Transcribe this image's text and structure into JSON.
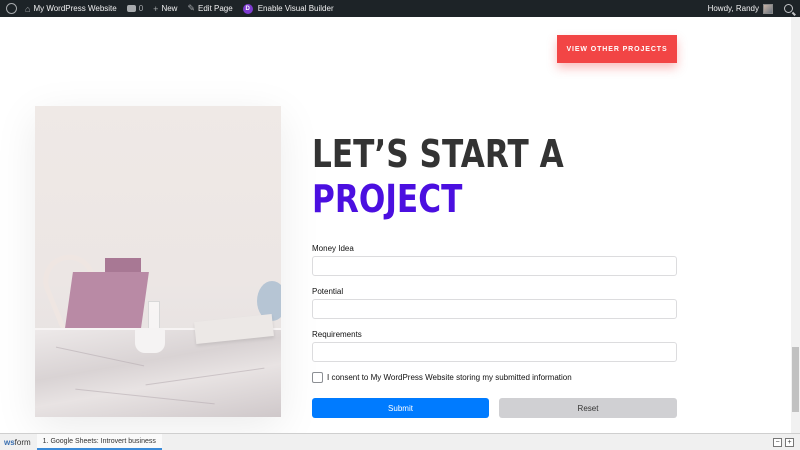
{
  "admin_bar": {
    "site_name": "My WordPress Website",
    "comments_count": "0",
    "new_label": "New",
    "edit_label": "Edit Page",
    "visual_builder_label": "Enable Visual Builder",
    "divi_letter": "D",
    "greeting": "Howdy, Randy"
  },
  "page": {
    "view_projects_label": "VIEW OTHER PROJECTS",
    "heading_line1": "LET’S START A",
    "heading_line2": "PROJECT",
    "accent_color": "#4b0fe0",
    "button_color": "#f24545"
  },
  "form": {
    "fields": [
      {
        "label": "Money Idea",
        "value": ""
      },
      {
        "label": "Potential",
        "value": ""
      },
      {
        "label": "Requirements",
        "value": ""
      }
    ],
    "consent_text": "I consent to My WordPress Website storing my submitted information",
    "consent_checked": false,
    "submit_label": "Submit",
    "reset_label": "Reset"
  },
  "bottom_bar": {
    "logo_ws": "ws",
    "logo_form": "form",
    "tab_label": "1. Google Sheets: Introvert business"
  },
  "icons": [
    "wordpress-icon",
    "comment-icon",
    "plus-icon",
    "pencil-icon",
    "divi-icon",
    "avatar",
    "search-icon",
    "minimize-icon",
    "expand-icon"
  ]
}
